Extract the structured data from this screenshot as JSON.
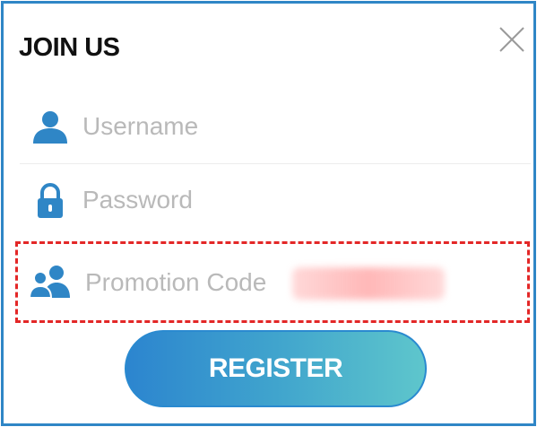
{
  "dialog": {
    "title": "JOIN US",
    "close_icon": "close-icon"
  },
  "form": {
    "username": {
      "placeholder": "Username",
      "value": "",
      "icon": "user-icon"
    },
    "password": {
      "placeholder": "Password",
      "value": "",
      "icon": "lock-icon"
    },
    "promotion_code": {
      "placeholder": "Promotion Code",
      "value": "",
      "icon": "users-icon",
      "redacted": true
    }
  },
  "register_label": "REGISTER",
  "colors": {
    "border": "#2f86c6",
    "icon": "#2f86c6",
    "highlight_dashed": "#e32727",
    "button_gradient_start": "#2c85cf",
    "button_gradient_end": "#5ec6cc",
    "placeholder": "#b9b9b9"
  }
}
